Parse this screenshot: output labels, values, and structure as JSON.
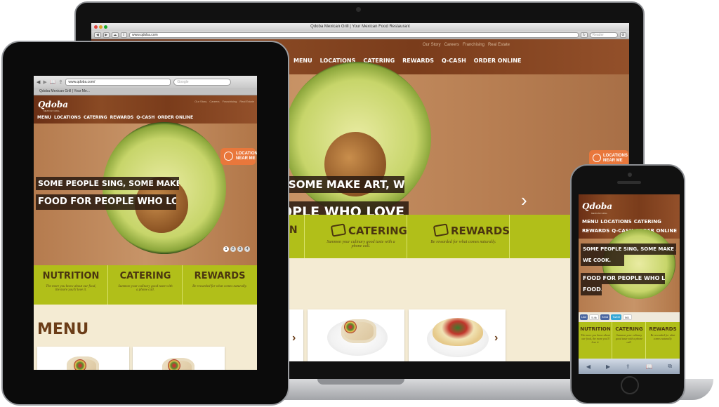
{
  "site": {
    "window_title": "Qdoba Mexican Grill | Your Mexican Food Restaurant",
    "url_laptop": "www.qdoba.com",
    "url_tablet": "www.qdoba.com/",
    "search_placeholder_laptop": "Reader",
    "search_placeholder_tablet": "Google",
    "tab_title_tablet": "Qdoba Mexican Grill | Your Me...",
    "logo": "Qdoba",
    "logo_sub": "MEXICAN GRILL",
    "top_links": [
      "Our Story",
      "Careers",
      "Franchising",
      "Real Estate"
    ],
    "nav": [
      "MENU",
      "LOCATIONS",
      "CATERING",
      "REWARDS",
      "Q-CASH",
      "ORDER ONLINE"
    ],
    "hero_line1": "SOME PEOPLE SING, SOME MAKE ART, WE COOK.",
    "hero_line2": "FOOD FOR PEOPLE WHO LOVE FOOD.",
    "laptop_hero_line1": ", SOME MAKE ART, WE COOK.",
    "laptop_hero_line2": "OPLE WHO LOVE FOOD.",
    "locations_badge": [
      "LOCATIONS",
      "NEAR ME"
    ],
    "slider_pages": [
      "1",
      "2",
      "3",
      "4"
    ],
    "active_slide": 1,
    "features": [
      {
        "title": "NUTRITION",
        "desc": "The more you know about our food, the more you'll love it."
      },
      {
        "title": "CATERING",
        "desc": "Summon your culinary good taste with a phone call."
      },
      {
        "title": "REWARDS",
        "desc": "Be rewarded for what comes naturally."
      }
    ],
    "laptop_feature_fragment": "ON",
    "section_menu": "MENU",
    "arrow_prev": "‹",
    "arrow_next": "›"
  },
  "phone": {
    "nav_row1": [
      "MENU",
      "LOCATIONS",
      "CATERING"
    ],
    "nav_row2": [
      "REWARDS",
      "Q-CASH",
      "ORDER ONLINE"
    ],
    "hero_lines": [
      "SOME PEOPLE SING, SOME MAKE ART,",
      "WE COOK.",
      "FOOD FOR PEOPLE WHO LOVE",
      "FOOD."
    ],
    "social": [
      {
        "label": "Like",
        "count": "5.4k"
      },
      {
        "label": "Send",
        "count": ""
      },
      {
        "label": "Tweet",
        "count": "561"
      }
    ],
    "features": [
      {
        "title": "NUTRITION",
        "desc": "The more you know about our food, the more you'll love it."
      },
      {
        "title": "CATERING",
        "desc": "Summon your culinary good taste with a phone call."
      },
      {
        "title": "REWARDS",
        "desc": "Be rewarded for what comes naturally."
      }
    ],
    "toolbar": [
      "◀",
      "▶",
      "⇪",
      "📖",
      "⧉"
    ]
  },
  "colors": {
    "wood": "#7a3c1b",
    "lime": "#b1bf19",
    "orange_badge": "#e9773b",
    "cream": "#f4ebd3"
  }
}
